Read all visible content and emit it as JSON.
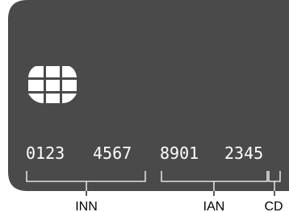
{
  "card": {
    "number_groups": [
      "0123",
      "4567",
      "8901",
      "2345"
    ],
    "body_color": "#4a4a4a",
    "text_color": "#ffffff"
  },
  "chip": {
    "icon": "sim-chip-icon",
    "color": "#ffffff"
  },
  "segments": {
    "inn": "INN",
    "ian": "IAN",
    "cd": "CD"
  }
}
